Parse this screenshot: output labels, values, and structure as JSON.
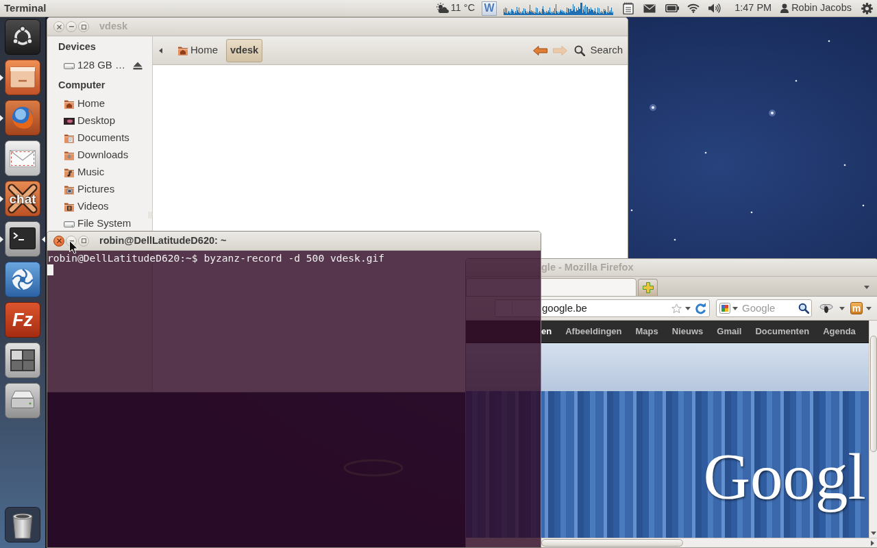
{
  "top_panel": {
    "app_title": "Terminal",
    "weather": "11 °C",
    "word_glyph": "W",
    "clock": "1:47 PM",
    "user": "Robin Jacobs"
  },
  "launcher": {
    "items": [
      {
        "kind": "dash",
        "running": false,
        "focused": false
      },
      {
        "kind": "files",
        "running": true,
        "focused": false
      },
      {
        "kind": "browser",
        "running": true,
        "focused": false
      },
      {
        "kind": "mail",
        "running": false,
        "focused": false
      },
      {
        "kind": "chat",
        "glyph": "chat",
        "running": true,
        "focused": false
      },
      {
        "kind": "terminal",
        "running": true,
        "focused": true
      },
      {
        "kind": "photos",
        "running": false,
        "focused": false
      },
      {
        "kind": "ftp",
        "glyph": "Fz",
        "running": false,
        "focused": false
      },
      {
        "kind": "workspaces",
        "running": false,
        "focused": false
      },
      {
        "kind": "drive",
        "running": false,
        "focused": false
      }
    ],
    "trash": {
      "kind": "trash"
    }
  },
  "file_manager": {
    "title": "vdesk",
    "active": false,
    "breadcrumbs": [
      {
        "label": "Home",
        "kind": "home",
        "selected": false
      },
      {
        "label": "vdesk",
        "selected": true
      }
    ],
    "back_enabled": true,
    "forward_enabled": false,
    "search": "Search",
    "sidebar": [
      {
        "heading": "Devices",
        "items": [
          {
            "label": "128 GB …",
            "kind": "drive",
            "eject": true
          }
        ]
      },
      {
        "heading": "Computer",
        "items": [
          {
            "label": "Home",
            "kind": "home"
          },
          {
            "label": "Desktop",
            "kind": "desktop"
          },
          {
            "label": "Documents",
            "kind": "documents"
          },
          {
            "label": "Downloads",
            "kind": "downloads"
          },
          {
            "label": "Music",
            "kind": "music"
          },
          {
            "label": "Pictures",
            "kind": "pictures"
          },
          {
            "label": "Videos",
            "kind": "videos"
          },
          {
            "label": "File System",
            "kind": "filesystem"
          }
        ]
      }
    ]
  },
  "terminal": {
    "title": "robin@DellLatitudeD620: ~",
    "active": true,
    "lines": [
      "robin@DellLatitudeD620:~$ byzanz-record -d 500 vdesk.gif"
    ],
    "cursor": true
  },
  "browser": {
    "title": "gle - Mozilla Firefox",
    "active": false,
    "tabs": [
      {
        "selected": true
      }
    ],
    "url": "google.be",
    "search": {
      "placeholder": "Google"
    },
    "extension_glyph": "m",
    "google_bar": [
      {
        "label": "en",
        "selected": true
      },
      {
        "label": "Afbeeldingen",
        "selected": false
      },
      {
        "label": "Maps",
        "selected": false
      },
      {
        "label": "Nieuws",
        "selected": false
      },
      {
        "label": "Gmail",
        "selected": false
      },
      {
        "label": "Documenten",
        "selected": false
      },
      {
        "label": "Agenda",
        "selected": false
      }
    ],
    "logo": "Googl"
  }
}
